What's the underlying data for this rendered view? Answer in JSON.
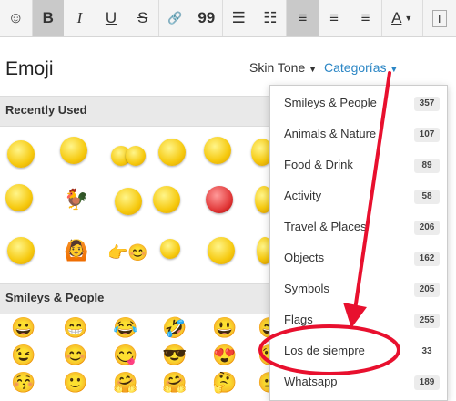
{
  "toolbar": {
    "bold": "B",
    "italic": "I",
    "underline": "U",
    "strike": "S",
    "link": "🔗",
    "quote": "99",
    "bullets": "☰",
    "numbers": "☷",
    "align_left": "≡",
    "align_center": "≡",
    "color": "A",
    "text_style": "T"
  },
  "panel": {
    "title": "Emoji",
    "skin_tone": "Skin Tone",
    "categories": "Categorías"
  },
  "sections": {
    "recent": "Recently Used",
    "smileys": "Smileys & People"
  },
  "smileys_row1": [
    "😀",
    "😁",
    "😂",
    "🤣",
    "😃",
    "😄"
  ],
  "smileys_row2": [
    "😉",
    "😊",
    "😋",
    "😎",
    "😍",
    "😘"
  ],
  "smileys_row3": [
    "😚",
    "🙂",
    "🤗",
    "🤗",
    "🤔",
    "😐"
  ],
  "dropdown": [
    {
      "label": "Smileys & People",
      "count": "357"
    },
    {
      "label": "Animals & Nature",
      "count": "107"
    },
    {
      "label": "Food & Drink",
      "count": "89"
    },
    {
      "label": "Activity",
      "count": "58"
    },
    {
      "label": "Travel & Places",
      "count": "206"
    },
    {
      "label": "Objects",
      "count": "162"
    },
    {
      "label": "Symbols",
      "count": "205"
    },
    {
      "label": "Flags",
      "count": "255"
    },
    {
      "label": "Los de siempre",
      "count": "33"
    },
    {
      "label": "Whatsapp",
      "count": "189"
    }
  ],
  "annotation_color": "#e8102e",
  "accent_color": "#2b86c5"
}
